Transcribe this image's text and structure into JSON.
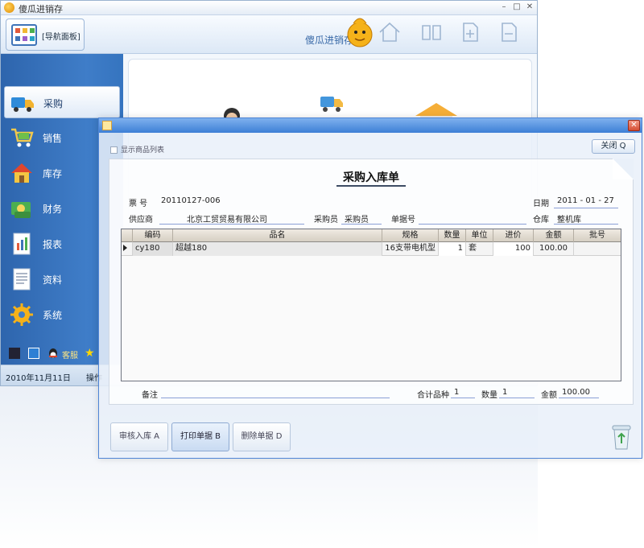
{
  "app": {
    "title": "傻瓜进销存",
    "brand": "傻瓜进销存",
    "nav_panel_label": "[导航面板]"
  },
  "sidebar": {
    "items": [
      {
        "label": "采购",
        "icon": "truck-icon",
        "active": true
      },
      {
        "label": "销售",
        "icon": "cart-icon",
        "active": false
      },
      {
        "label": "库存",
        "icon": "house-icon",
        "active": false
      },
      {
        "label": "财务",
        "icon": "money-icon",
        "active": false
      },
      {
        "label": "报表",
        "icon": "report-icon",
        "active": false
      },
      {
        "label": "资料",
        "icon": "document-icon",
        "active": false
      },
      {
        "label": "系统",
        "icon": "gear-icon",
        "active": false
      }
    ],
    "qq_label": "客服"
  },
  "status_bar": {
    "date": "2010年11月11日",
    "operator_prefix": "操作"
  },
  "modal": {
    "show_list_label": "显示商品列表",
    "close_label": "关闭",
    "doc_title": "采购入库单",
    "fields": {
      "no_label": "票  号",
      "no_value": "20110127-006",
      "date_label": "日期",
      "date_value": "2011 - 01 - 27",
      "supplier_label": "供应商",
      "supplier_value": "北京工贸贸易有限公司",
      "buyer_label": "采购员",
      "buyer_value": "采购员",
      "order_label": "单据号",
      "order_value": "",
      "warehouse_label": "仓库",
      "warehouse_value": "整机库",
      "remark_label": "备注",
      "total_kinds_label": "合计品种",
      "total_kinds_value": "1",
      "qty_label": "数量",
      "qty_value": "1",
      "amount_label": "金额",
      "amount_value": "100.00"
    },
    "table": {
      "columns": [
        "编码",
        "品名",
        "规格",
        "数量",
        "单位",
        "进价",
        "金额",
        "批号"
      ],
      "rows": [
        [
          "cy180",
          "超越180",
          "16支带电机型",
          "1",
          "套",
          "100",
          "100.00",
          ""
        ]
      ]
    },
    "buttons": {
      "audit": "审核入库",
      "audit_key": "A",
      "print": "打印单据",
      "print_key": "B",
      "delete": "删除单据",
      "delete_key": "D"
    }
  },
  "colors": {
    "sidebar_blue": "#3f7dc8",
    "modal_border": "#4f85d6",
    "close_red": "#d54d32"
  }
}
